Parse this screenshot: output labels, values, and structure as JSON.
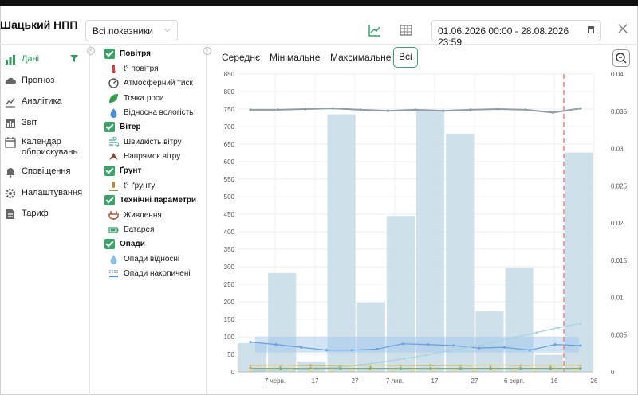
{
  "header": {
    "station_name": "Шацький НПП",
    "indicator_select": "Всі показники",
    "date_range": "01.06.2026 00:00 - 28.08.2026 23:59"
  },
  "sidebar": {
    "items": [
      {
        "label": "Дані",
        "icon": "bar-chart-icon",
        "active": true
      },
      {
        "label": "Прогноз",
        "icon": "cloud-icon"
      },
      {
        "label": "Аналітика",
        "icon": "analytics-icon"
      },
      {
        "label": "Звіт",
        "icon": "report-icon"
      },
      {
        "label": "Календар обприскувань",
        "icon": "calendar-icon"
      },
      {
        "label": "Сповіщення",
        "icon": "bell-icon"
      },
      {
        "label": "Налаштування",
        "icon": "gear-icon"
      },
      {
        "label": "Тариф",
        "icon": "tariff-icon"
      }
    ]
  },
  "params": {
    "groups": [
      {
        "label": "Повітря",
        "items": [
          "t° повітря",
          "Атмосферний тиск",
          "Точка роси",
          "Відносна вологість"
        ]
      },
      {
        "label": "Вітер",
        "items": [
          "Швидкість вітру",
          "Напрямок вітру"
        ]
      },
      {
        "label": "Ґрунт",
        "items": [
          "t° ґрунту"
        ]
      },
      {
        "label": "Технічні параметри",
        "items": [
          "Живлення",
          "Батарея"
        ]
      },
      {
        "label": "Опади",
        "items": [
          "Опади відносні",
          "Опади накопичені"
        ]
      }
    ]
  },
  "tabs": [
    {
      "label": "Середнє"
    },
    {
      "label": "Мінімальне"
    },
    {
      "label": "Максимальне"
    },
    {
      "label": "Всі",
      "active": true
    }
  ],
  "colors": {
    "accent": "#3aa46a",
    "bars": "#c5dce8",
    "today_line": "#e88a80"
  },
  "chart_data": {
    "type": "bar",
    "y_left": {
      "min": 0,
      "max": 850,
      "ticks": [
        0,
        50,
        100,
        150,
        200,
        250,
        300,
        350,
        400,
        450,
        500,
        550,
        600,
        650,
        700,
        750,
        800,
        850
      ]
    },
    "y_right": {
      "min": 0,
      "max": 0.04,
      "ticks": [
        "0",
        "0.005",
        "0.01",
        "0.015",
        "0.02",
        "0.025",
        "0.03",
        "0.035",
        "0.04"
      ]
    },
    "x_ticks": [
      "7 черв.",
      "17",
      "27",
      "7 лип.",
      "17",
      "27",
      "6 серп.",
      "16",
      "26"
    ],
    "bars": [
      82,
      282,
      30,
      735,
      198,
      445,
      748,
      680,
      173,
      298,
      48,
      626
    ],
    "series": [
      {
        "values": [
          748,
          748,
          750,
          752,
          748,
          745,
          748,
          745,
          748,
          750,
          748,
          740,
          752
        ],
        "color": "#8f9ea8"
      },
      {
        "values": [
          85,
          78,
          70,
          62,
          62,
          65,
          80,
          78,
          75,
          68,
          70,
          62,
          78,
          75
        ],
        "color": "#6aa2e2"
      },
      {
        "values": [
          2,
          4,
          6,
          10,
          14,
          20,
          28,
          38,
          48,
          60,
          72,
          84,
          98,
          112,
          126,
          138
        ],
        "color": "#a9d4dd"
      },
      {
        "values": [
          18,
          17,
          19,
          18,
          17,
          18,
          19,
          18,
          17,
          18,
          17,
          18
        ],
        "color": "#d9b86a"
      },
      {
        "values": [
          10,
          10,
          10,
          10,
          10,
          10,
          10,
          10,
          10,
          10,
          10,
          10
        ],
        "color": "#7ab36f"
      }
    ],
    "band": {
      "low": 55,
      "high": 100
    }
  }
}
